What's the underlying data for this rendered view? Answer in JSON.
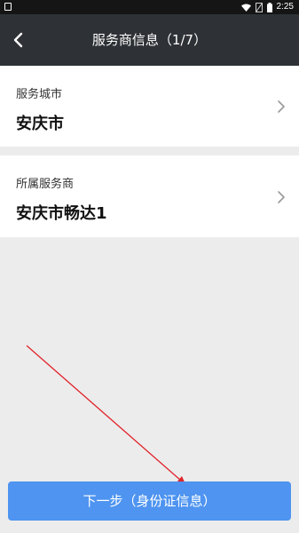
{
  "status_bar": {
    "time": "2:25",
    "icons": [
      "notification-icon",
      "wifi-icon",
      "no-sim-icon",
      "battery-icon"
    ]
  },
  "header": {
    "title": "服务商信息（1/7）",
    "back_icon": "chevron-left-icon"
  },
  "fields": [
    {
      "label": "服务城市",
      "value": "安庆市"
    },
    {
      "label": "所属服务商",
      "value": "安庆市畅达1"
    }
  ],
  "next_button": {
    "label": "下一步（身份证信息）"
  },
  "colors": {
    "header_bg": "#2e3135",
    "status_bg": "#151515",
    "page_bg": "#ececec",
    "button_bg": "#4e94f0",
    "annotation_arrow": "#e0242a"
  }
}
